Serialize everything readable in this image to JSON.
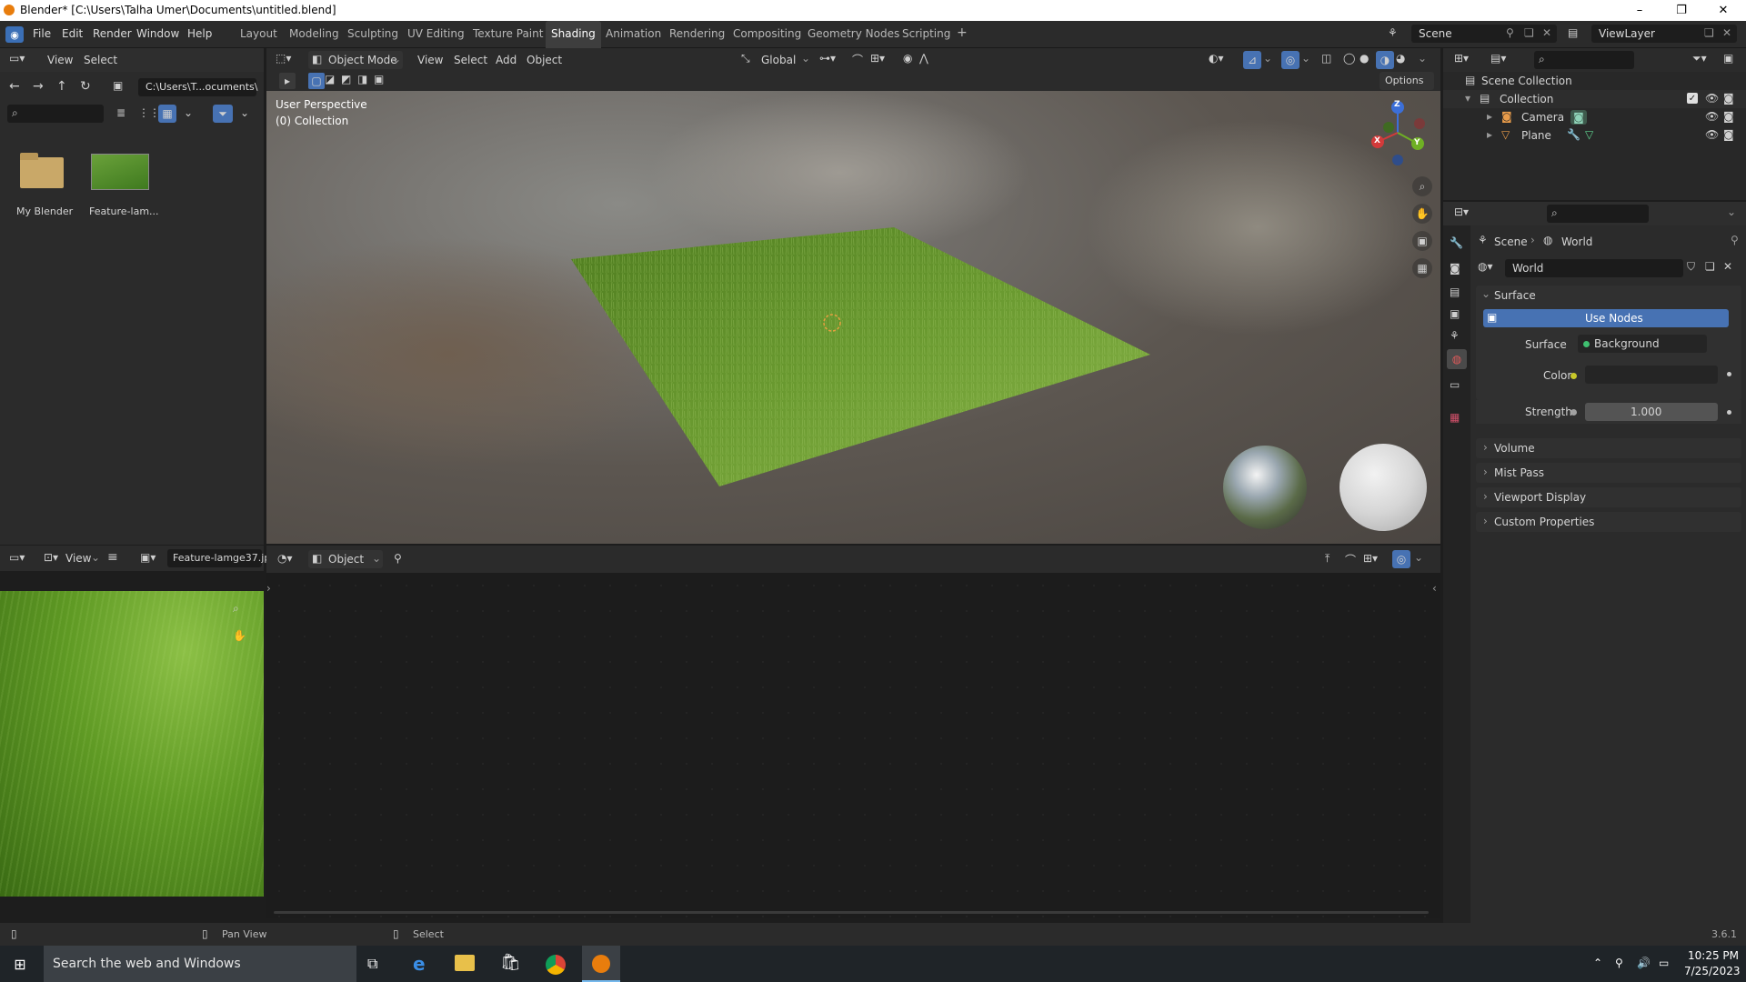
{
  "window": {
    "title": "Blender* [C:\\Users\\Talha Umer\\Documents\\untitled.blend]",
    "min": "–",
    "max": "❐",
    "close": "✕"
  },
  "menu": [
    "File",
    "Edit",
    "Render",
    "Window",
    "Help"
  ],
  "workspaces": [
    "Layout",
    "Modeling",
    "Sculpting",
    "UV Editing",
    "Texture Paint",
    "Shading",
    "Animation",
    "Rendering",
    "Compositing",
    "Geometry Nodes",
    "Scripting"
  ],
  "active_workspace": "Shading",
  "scene": {
    "name": "Scene",
    "view_layer": "ViewLayer"
  },
  "file_browser": {
    "menu": [
      "View",
      "Select"
    ],
    "path": "C:\\Users\\T...ocuments\\",
    "items": [
      {
        "label": "My Blender",
        "type": "folder-icon"
      },
      {
        "label": "Feature-lam...",
        "type": "image-thumb"
      }
    ]
  },
  "viewport": {
    "mode": "Object Mode",
    "menu": [
      "View",
      "Select",
      "Add",
      "Object"
    ],
    "orientation": "Global",
    "options_label": "Options",
    "overlay_line1": "User Perspective",
    "overlay_line2": "(0) Collection",
    "gizmo": {
      "z": "Z",
      "x": "X",
      "y": "Y"
    }
  },
  "image_editor": {
    "view_label": "View",
    "image_name": "Feature-lamge37.jp"
  },
  "node_editor": {
    "object_label": "Object"
  },
  "outliner": {
    "root": "Scene Collection",
    "collection": "Collection",
    "objects": [
      {
        "name": "Camera",
        "icon": "camera-icon"
      },
      {
        "name": "Plane",
        "icon": "mesh-icon"
      }
    ]
  },
  "properties": {
    "breadcrumb": [
      "Scene",
      "World"
    ],
    "world_name": "World",
    "panels": {
      "surface": "Surface",
      "use_nodes": "Use Nodes",
      "surface_label": "Surface",
      "surface_value": "Background",
      "color_label": "Color",
      "strength_label": "Strength",
      "strength_value": "1.000",
      "collapsed": [
        "Volume",
        "Mist Pass",
        "Viewport Display",
        "Custom Properties"
      ]
    }
  },
  "statusbar": {
    "left": "Pan View",
    "middle": "Select",
    "version": "3.6.1"
  },
  "taskbar": {
    "search": "Search the web and Windows",
    "time": "10:25 PM",
    "date": "7/25/2023"
  },
  "colors": {
    "accent_blue": "#4772b3",
    "grass": "#5e8a2a",
    "header": "#2e2e2e",
    "bg": "#1d1d1d"
  }
}
